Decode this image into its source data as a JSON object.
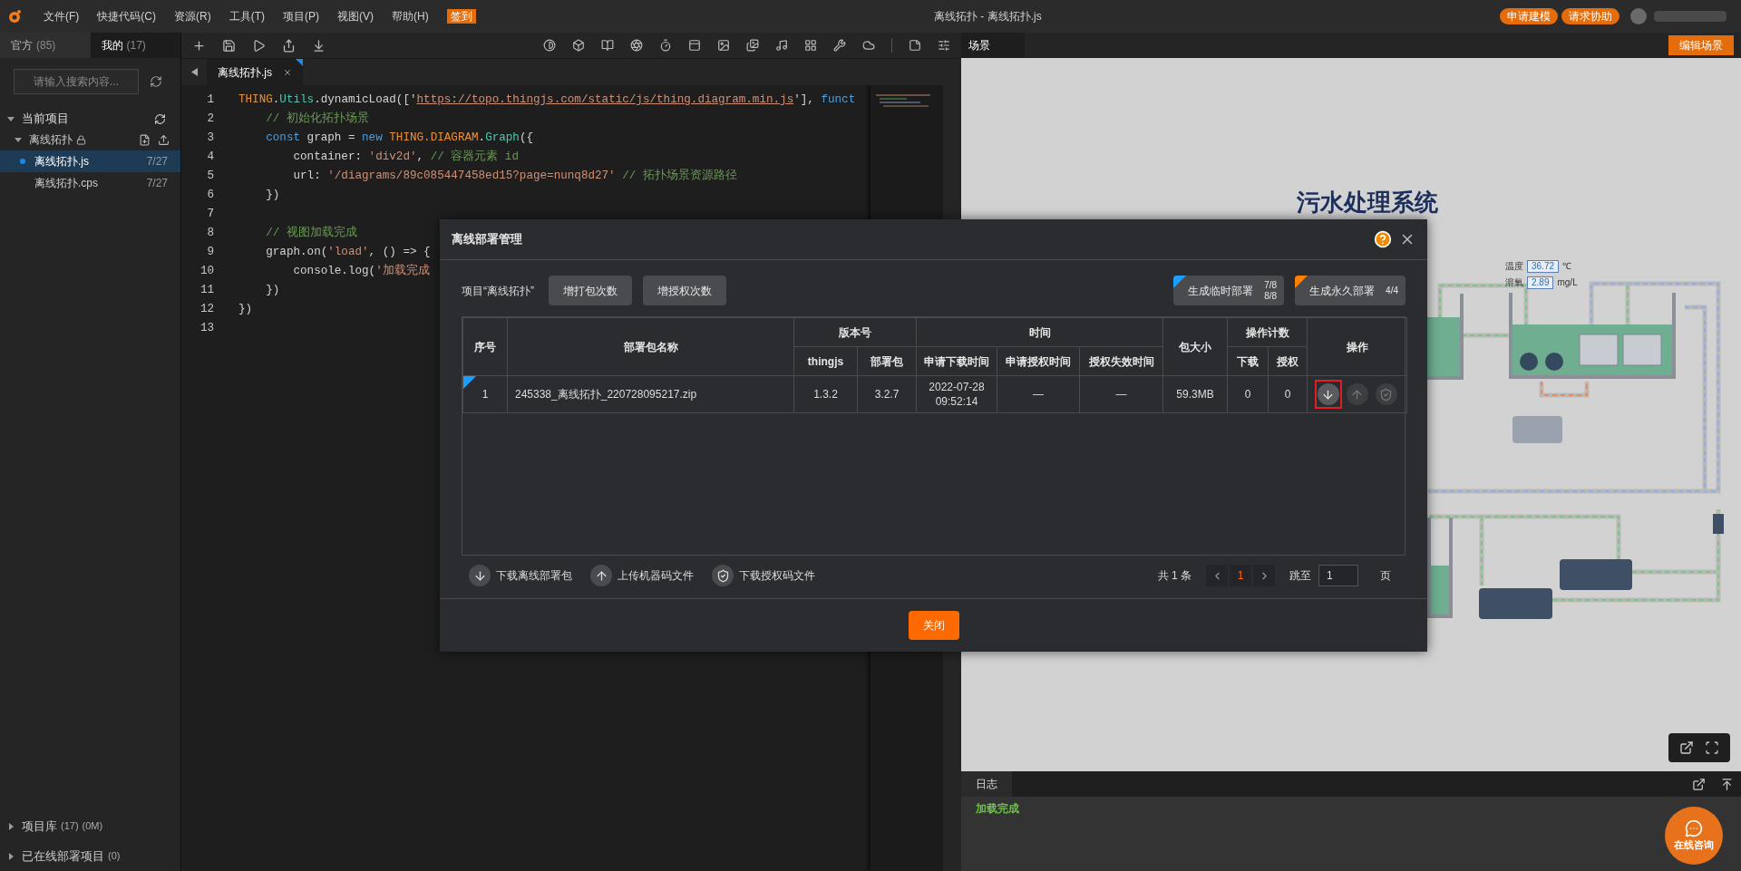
{
  "menu_bar": {
    "items": [
      {
        "label": "文件(F)"
      },
      {
        "label": "快捷代码(C)"
      },
      {
        "label": "资源(R)"
      },
      {
        "label": "工具(T)"
      },
      {
        "label": "项目(P)"
      },
      {
        "label": "视图(V)"
      },
      {
        "label": "帮助(H)"
      }
    ],
    "checkin": "签到",
    "title": "离线拓扑 - 离线拓扑.js",
    "actions": [
      "申请建模",
      "请求协助"
    ]
  },
  "sidebar": {
    "tabs": [
      {
        "label": "官方",
        "count": "(85)",
        "selected": false
      },
      {
        "label": "我的",
        "count": "(17)",
        "selected": true
      }
    ],
    "search": {
      "placeholder": "请输入搜索内容..."
    },
    "current_project": {
      "title": "当前项目",
      "expanded": true,
      "project": {
        "name": "离线拓扑",
        "expanded": true,
        "locked": true,
        "files": [
          {
            "name": "离线拓扑.js",
            "date": "7/27",
            "selected": true,
            "modified": true
          },
          {
            "name": "离线拓扑.cps",
            "date": "7/27",
            "selected": false,
            "modified": false
          }
        ]
      }
    },
    "sections": [
      {
        "label": "项目库",
        "details": [
          "(17)",
          "(0M)"
        ],
        "expanded": false
      },
      {
        "label": "已在线部署项目",
        "details": [
          "(0)"
        ],
        "expanded": false
      }
    ]
  },
  "editor": {
    "tabs": [
      {
        "name": "离线拓扑.js",
        "selected": true,
        "modified": true
      }
    ],
    "lines": [
      {
        "number": "1",
        "tokens": [
          {
            "text": "THING",
            "kind": "obj"
          },
          {
            "text": ".",
            "kind": "plain"
          },
          {
            "text": "Utils",
            "kind": "type"
          },
          {
            "text": ".dynamicLoad(['",
            "kind": "plain"
          },
          {
            "text": "https://topo.thingjs.com/static/js/thing.diagram.min.js",
            "kind": "url"
          },
          {
            "text": "'], ",
            "kind": "plain"
          },
          {
            "text": "funct",
            "kind": "kw"
          }
        ]
      },
      {
        "number": "2",
        "tokens": [
          {
            "text": "    // 初始化拓扑场景",
            "kind": "comment"
          }
        ]
      },
      {
        "number": "3",
        "tokens": [
          {
            "text": "    const",
            "kind": "kw"
          },
          {
            "text": " graph = ",
            "kind": "plain"
          },
          {
            "text": "new",
            "kind": "kw"
          },
          {
            "text": " THING.DIAGRAM",
            "kind": "obj"
          },
          {
            "text": ".",
            "kind": "plain"
          },
          {
            "text": "Graph",
            "kind": "type"
          },
          {
            "text": "({",
            "kind": "plain"
          }
        ]
      },
      {
        "number": "4",
        "tokens": [
          {
            "text": "        container: ",
            "kind": "plain"
          },
          {
            "text": "'div2d'",
            "kind": "str"
          },
          {
            "text": ", ",
            "kind": "plain"
          },
          {
            "text": "// 容器元素 id",
            "kind": "comment"
          }
        ]
      },
      {
        "number": "5",
        "tokens": [
          {
            "text": "        url: ",
            "kind": "plain"
          },
          {
            "text": "'/diagrams/89c085447458ed15?page=nunq8d27'",
            "kind": "str"
          },
          {
            "text": " // 拓扑场景资源路径",
            "kind": "comment"
          }
        ]
      },
      {
        "number": "6",
        "tokens": [
          {
            "text": "    })",
            "kind": "plain"
          }
        ]
      },
      {
        "number": "7"
      },
      {
        "number": "8",
        "tokens": [
          {
            "text": "    // 视图加载完成",
            "kind": "comment"
          }
        ]
      },
      {
        "number": "9",
        "tokens": [
          {
            "text": "    graph.on(",
            "kind": "plain"
          },
          {
            "text": "'load'",
            "kind": "str"
          },
          {
            "text": ", () => {",
            "kind": "plain"
          }
        ]
      },
      {
        "number": "10",
        "tokens": [
          {
            "text": "        console.log(",
            "kind": "plain"
          },
          {
            "text": "'加载完成",
            "kind": "str"
          }
        ]
      },
      {
        "number": "11",
        "tokens": [
          {
            "text": "    })",
            "kind": "plain"
          }
        ]
      },
      {
        "number": "12",
        "tokens": [
          {
            "text": "})",
            "kind": "plain"
          }
        ]
      },
      {
        "number": "13"
      }
    ]
  },
  "scene": {
    "tab": "场景",
    "edit_button": "编辑场景",
    "title": "污水处理系统",
    "readouts": [
      {
        "label": "温度",
        "value": "36.72",
        "unit": "℃"
      },
      {
        "label": "溶氧",
        "value": "2.89",
        "unit": "mg/L"
      }
    ]
  },
  "log": {
    "tab": "日志",
    "messages": [
      {
        "text": "加载完成",
        "kind": "success"
      }
    ]
  },
  "chat_button": "在线咨询",
  "dialog": {
    "title": "离线部署管理",
    "project_label": "项目“离线拓扑”",
    "buttons": [
      "增打包次数",
      "增授权次数"
    ],
    "generate": [
      {
        "label": "生成临时部署",
        "color": "#1e9fff",
        "counts": [
          "7/8",
          "8/8"
        ]
      },
      {
        "label": "生成永久部署",
        "color": "#ff7f00",
        "counts": [
          "4/4"
        ]
      }
    ],
    "table": {
      "header_rows": [
        [
          {
            "label": "序号",
            "rowspan": 2
          },
          {
            "label": "部署包名称",
            "rowspan": 2
          },
          {
            "label": "版本号",
            "colspan": 2
          },
          {
            "label": "时间",
            "colspan": 3
          },
          {
            "label": "包大小",
            "rowspan": 2
          },
          {
            "label": "操作计数",
            "colspan": 2
          },
          {
            "label": "操作",
            "rowspan": 2
          }
        ],
        [
          {
            "label": "thingjs"
          },
          {
            "label": "部署包"
          },
          {
            "label": "申请下载时间"
          },
          {
            "label": "申请授权时间"
          },
          {
            "label": "授权失效时间"
          },
          {
            "label": "下载"
          },
          {
            "label": "授权"
          }
        ]
      ],
      "rows": [
        {
          "flagged": true,
          "cells": [
            "1",
            "245338_离线拓扑_220728095217.zip",
            "1.3.2",
            "3.2.7",
            "2022-07-28 09:52:14",
            "—",
            "—",
            "59.3MB",
            "0",
            "0"
          ],
          "actions": [
            {
              "kind": "download",
              "focused": true,
              "disabled": false
            },
            {
              "kind": "upload",
              "focused": false,
              "disabled": true
            },
            {
              "kind": "shield",
              "focused": false,
              "disabled": true
            }
          ]
        }
      ]
    },
    "legend": [
      {
        "kind": "download",
        "label": "下载离线部署包"
      },
      {
        "kind": "upload",
        "label": "上传机器码文件"
      },
      {
        "kind": "shield",
        "label": "下载授权码文件"
      }
    ],
    "pagination": {
      "total": "共 1 条",
      "pages": [
        {
          "label": "1",
          "selected": true
        }
      ],
      "jump_label": "跳至",
      "jump_value": "1",
      "suffix": "页"
    },
    "close_button": "关闭"
  }
}
